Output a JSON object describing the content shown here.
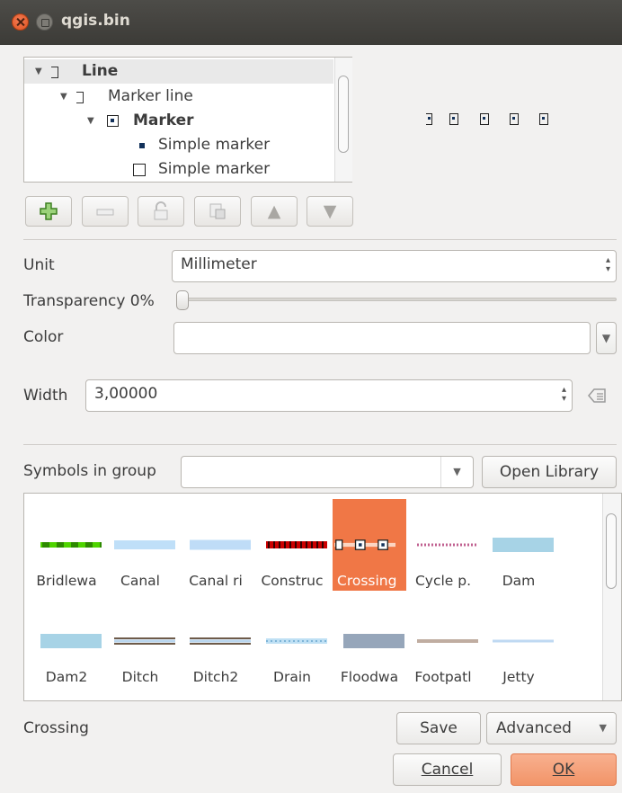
{
  "window": {
    "title": "qgis.bin"
  },
  "tree": {
    "items": [
      {
        "label": "Line",
        "bold": true
      },
      {
        "label": "Marker line",
        "bold": false
      },
      {
        "label": "Marker",
        "bold": true
      },
      {
        "label": "Simple marker",
        "bold": false
      },
      {
        "label": "Simple marker",
        "bold": false
      }
    ]
  },
  "layer_toolbar": {
    "buttons": [
      "add-layer-icon",
      "remove-layer-icon",
      "lock-icon",
      "duplicate-icon",
      "arrow-up-icon",
      "arrow-down-icon"
    ]
  },
  "form": {
    "unit_label": "Unit",
    "unit_value": "Millimeter",
    "transparency_label": "Transparency 0%",
    "transparency_value": 0,
    "color_label": "Color",
    "width_label": "Width",
    "width_value": "3,00000"
  },
  "library": {
    "symbols_label": "Symbols in group",
    "group_value": "",
    "open_library_label": "Open Library",
    "symbols": [
      {
        "name": "Bridlewa",
        "style": "bridleway"
      },
      {
        "name": "Canal",
        "style": "canal"
      },
      {
        "name": "Canal ri",
        "style": "canal-river"
      },
      {
        "name": "Construc",
        "style": "construction"
      },
      {
        "name": "Crossing",
        "style": "crossing",
        "selected": true
      },
      {
        "name": "Cycle p.",
        "style": "cycle-path"
      },
      {
        "name": "Dam",
        "style": "dam"
      },
      {
        "name": "Dam2",
        "style": "dam2"
      },
      {
        "name": "Ditch",
        "style": "ditch"
      },
      {
        "name": "Ditch2",
        "style": "ditch2"
      },
      {
        "name": "Drain",
        "style": "drain"
      },
      {
        "name": "Floodwa",
        "style": "floodway"
      },
      {
        "name": "Footpatl",
        "style": "footpath"
      },
      {
        "name": "Jetty",
        "style": "jetty"
      }
    ],
    "selected_name": "Crossing"
  },
  "footer": {
    "save_label": "Save",
    "advanced_label": "Advanced",
    "cancel_label": "Cancel",
    "ok_label": "OK"
  },
  "colors": {
    "accent": "#f07746",
    "ok_button": "#f6a47f"
  }
}
